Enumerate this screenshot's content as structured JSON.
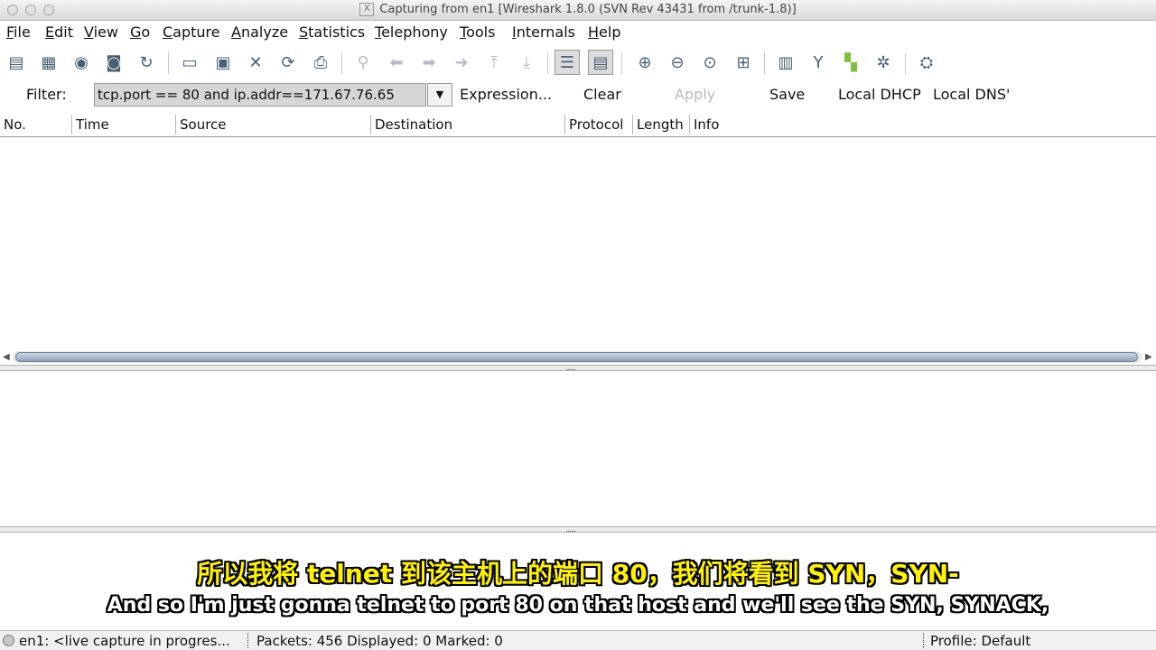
{
  "window": {
    "title": "Capturing from en1   [Wireshark 1.8.0  (SVN Rev 43431 from /trunk-1.8)]",
    "x11_glyph": "X"
  },
  "menu": [
    "File",
    "Edit",
    "View",
    "Go",
    "Capture",
    "Analyze",
    "Statistics",
    "Telephony",
    "Tools",
    "Internals",
    "Help"
  ],
  "toolbar_icons": [
    "interfaces-icon",
    "options-icon",
    "start-capture-icon",
    "stop-capture-icon",
    "restart-capture-icon",
    "open-file-icon",
    "save-file-icon",
    "close-file-icon",
    "reload-icon",
    "print-icon",
    "find-packet-icon",
    "go-back-icon",
    "go-forward-icon",
    "go-to-packet-icon",
    "go-first-icon",
    "go-last-icon",
    "colorize-icon",
    "auto-scroll-icon",
    "zoom-in-icon",
    "zoom-out-icon",
    "normal-size-icon",
    "resize-columns-icon",
    "capture-filters-icon",
    "display-filters-icon",
    "coloring-rules-icon",
    "preferences-icon",
    "help-icon"
  ],
  "filter": {
    "label": "Filter:",
    "value": "tcp.port == 80 and ip.addr==171.67.76.65",
    "buttons": [
      "Expression...",
      "Clear",
      "Apply",
      "Save",
      "Local DHCP",
      "Local DNS'"
    ]
  },
  "columns": [
    "No.",
    "Time",
    "Source",
    "Destination",
    "Protocol",
    "Length",
    "Info"
  ],
  "subtitles": {
    "chinese": "所以我将 telnet 到该主机上的端口 80，我们将看到 SYN，SYN-",
    "english": "And so I'm just gonna telnet to port 80 on that host and we'll see the SYN, SYNACK,"
  },
  "status": {
    "capture": "en1: <live capture in progres...",
    "packets": "Packets: 456 Displayed: 0 Marked: 0",
    "profile": "Profile: Default"
  }
}
